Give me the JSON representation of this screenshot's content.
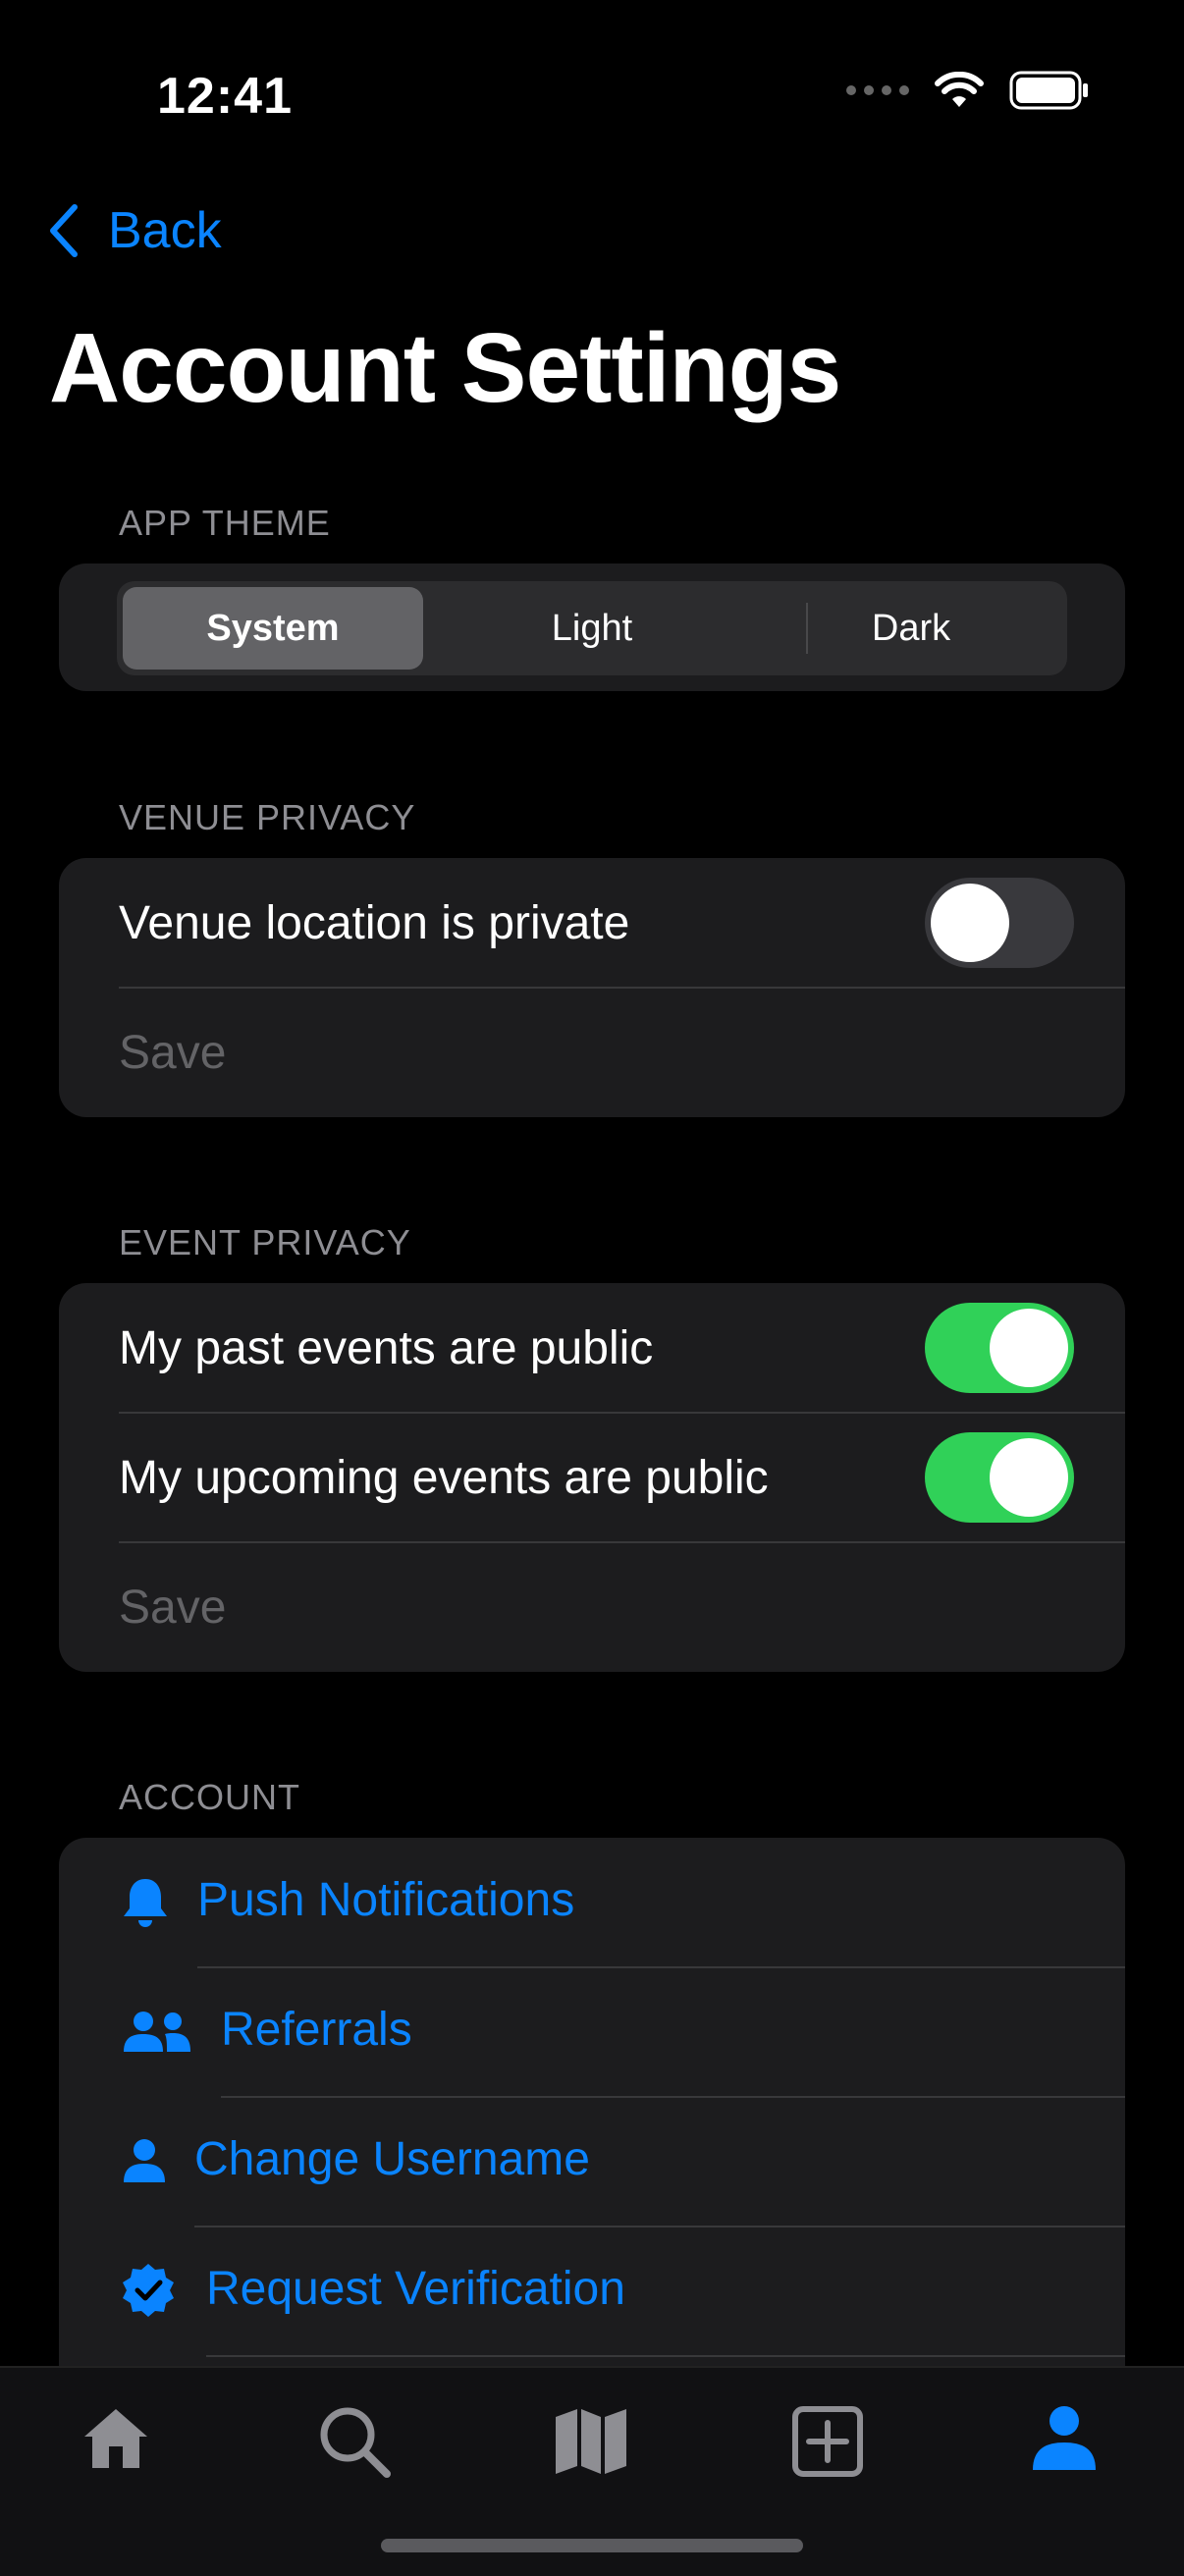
{
  "status_bar": {
    "time": "12:41"
  },
  "nav": {
    "back_label": "Back"
  },
  "page_title": "Account Settings",
  "app_theme": {
    "label": "APP THEME",
    "options": [
      "System",
      "Light",
      "Dark"
    ],
    "selected": "System"
  },
  "venue_privacy": {
    "label": "VENUE PRIVACY",
    "toggle_label": "Venue location is private",
    "toggle_on": false,
    "save_label": "Save"
  },
  "event_privacy": {
    "label": "EVENT PRIVACY",
    "past_label": "My past events are public",
    "past_on": true,
    "upcoming_label": "My upcoming events are public",
    "upcoming_on": true,
    "save_label": "Save"
  },
  "account": {
    "label": "ACCOUNT",
    "items": [
      {
        "label": "Push Notifications",
        "icon": "bell-icon"
      },
      {
        "label": "Referrals",
        "icon": "people-icon"
      },
      {
        "label": "Change Username",
        "icon": "person-icon"
      },
      {
        "label": "Request Verification",
        "icon": "verified-badge-icon"
      }
    ]
  },
  "tabbar": {
    "items": [
      {
        "icon": "home-icon",
        "selected": false
      },
      {
        "icon": "search-icon",
        "selected": false
      },
      {
        "icon": "map-icon",
        "selected": false
      },
      {
        "icon": "add-square-icon",
        "selected": false
      },
      {
        "icon": "profile-icon",
        "selected": true
      }
    ]
  },
  "colors": {
    "accent": "#0a84ff",
    "toggle_on": "#30d158",
    "card": "#1c1c1e",
    "background": "#000000"
  }
}
